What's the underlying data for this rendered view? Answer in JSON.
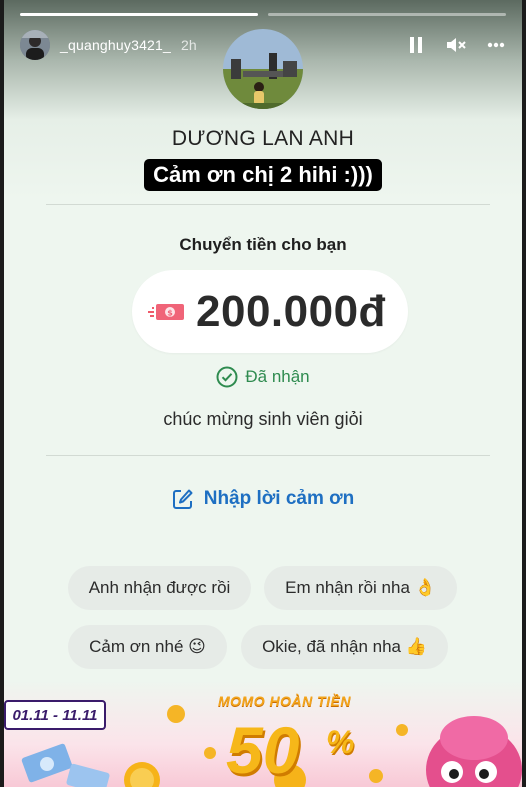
{
  "story": {
    "username": "_quanghuy3421_",
    "time": "2h",
    "progress_segments": [
      1.0,
      0.0
    ],
    "icons": {
      "pause": "pause-icon",
      "mute": "mute-icon",
      "more": "more-icon"
    }
  },
  "transfer": {
    "recipient_name": "DƯƠNG LAN ANH",
    "caption": "Cảm ơn chị 2 hihi :)))",
    "title": "Chuyển tiền cho bạn",
    "amount": "200.000đ",
    "status": "Đã nhận",
    "message": "chúc mừng sinh viên giỏi",
    "thanks_link": "Nhập lời cảm ơn"
  },
  "quick_replies": [
    "Anh nhận được rồi",
    "Em nhận rồi nha 👌",
    "Cảm ơn nhé 😉",
    "Okie, đã nhận nha 👍"
  ],
  "banner": {
    "dates": "01.11 - 11.11",
    "promo": "MOMO HOÀN TIỀN",
    "percent": "50",
    "percent_sign": "%"
  },
  "colors": {
    "status_green": "#2e8b4f",
    "link_blue": "#1e6fc2",
    "caption_bg": "#000000",
    "banner_gold": "#f6b719"
  }
}
